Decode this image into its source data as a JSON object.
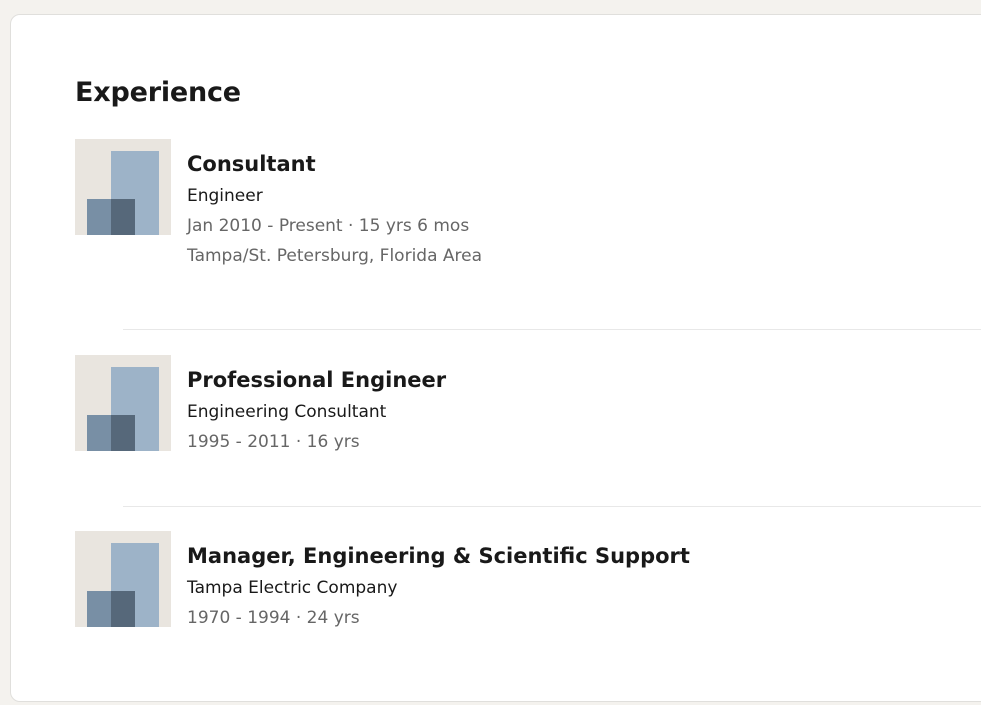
{
  "section": {
    "title": "Experience"
  },
  "experiences": [
    {
      "title": "Consultant",
      "company": "Engineer",
      "dates": "Jan 2010 - Present · 15 yrs 6 mos",
      "location": "Tampa/St. Petersburg, Florida Area",
      "logo_icon": "company-placeholder-icon"
    },
    {
      "title": "Professional Engineer",
      "company": "Engineering Consultant",
      "dates": "1995 - 2011 · 16 yrs",
      "logo_icon": "company-placeholder-icon"
    },
    {
      "title": "Manager, Engineering & Scientific Support",
      "company": "Tampa Electric Company",
      "dates": "1970 - 1994 · 24 yrs",
      "logo_icon": "company-placeholder-icon"
    }
  ],
  "colors": {
    "logo_background": "#e9e5df",
    "logo_light": "#9db3c8",
    "logo_mid": "#788fa5",
    "logo_dark": "#56687a",
    "secondary_text": "#666666"
  }
}
